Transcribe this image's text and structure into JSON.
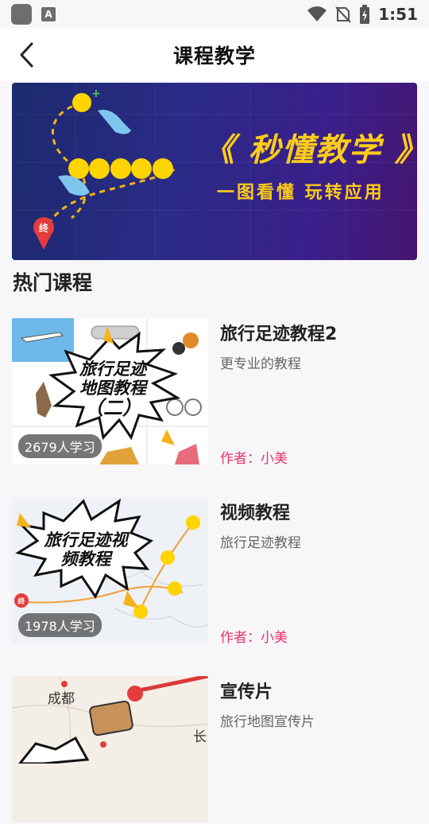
{
  "status_bar": {
    "time": "1:51",
    "a_icon": "A"
  },
  "header": {
    "title": "课程教学",
    "back_icon": "chevron-left-icon"
  },
  "banner": {
    "title": "《 秒懂教学 》",
    "subtitle": "一图看懂  玩转应用",
    "end_marker": "终"
  },
  "section": {
    "title": "热门课程"
  },
  "courses": [
    {
      "title": "旅行足迹教程2",
      "desc": "更专业的教程",
      "author": "作者：小美",
      "learners": "2679人学习",
      "thumb_text": "旅行足迹\n地图教程\n（二）"
    },
    {
      "title": "视频教程",
      "desc": "旅行足迹教程",
      "author": "作者：小美",
      "learners": "1978人学习",
      "thumb_text": "旅行足迹视\n频教程",
      "end_marker": "终"
    },
    {
      "title": "宣传片",
      "desc": "旅行地图宣传片",
      "thumb_city_1": "成都",
      "thumb_city_2": "长"
    }
  ],
  "colors": {
    "accent_author": "#e8336b",
    "banner_yellow": "#ffcc1a"
  }
}
